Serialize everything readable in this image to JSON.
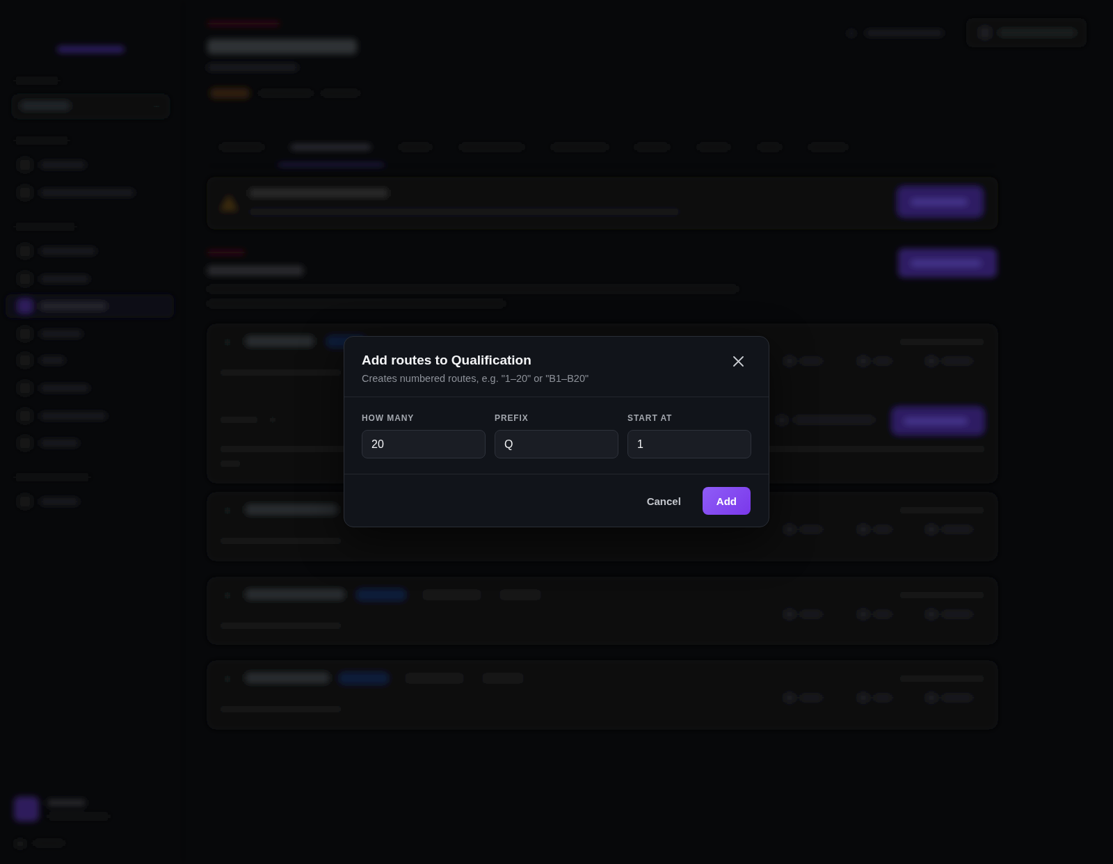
{
  "dialog": {
    "title": "Add routes to Qualification",
    "subtitle": "Creates numbered routes, e.g. \"1–20\" or \"B1–B20\"",
    "fields": [
      {
        "label": "HOW MANY",
        "value": "20"
      },
      {
        "label": "PREFIX",
        "value": "Q"
      },
      {
        "label": "START AT",
        "value": "1"
      }
    ],
    "buttons": [
      {
        "label": "Cancel",
        "kind": "secondary"
      },
      {
        "label": "Add",
        "kind": "primary"
      }
    ]
  }
}
